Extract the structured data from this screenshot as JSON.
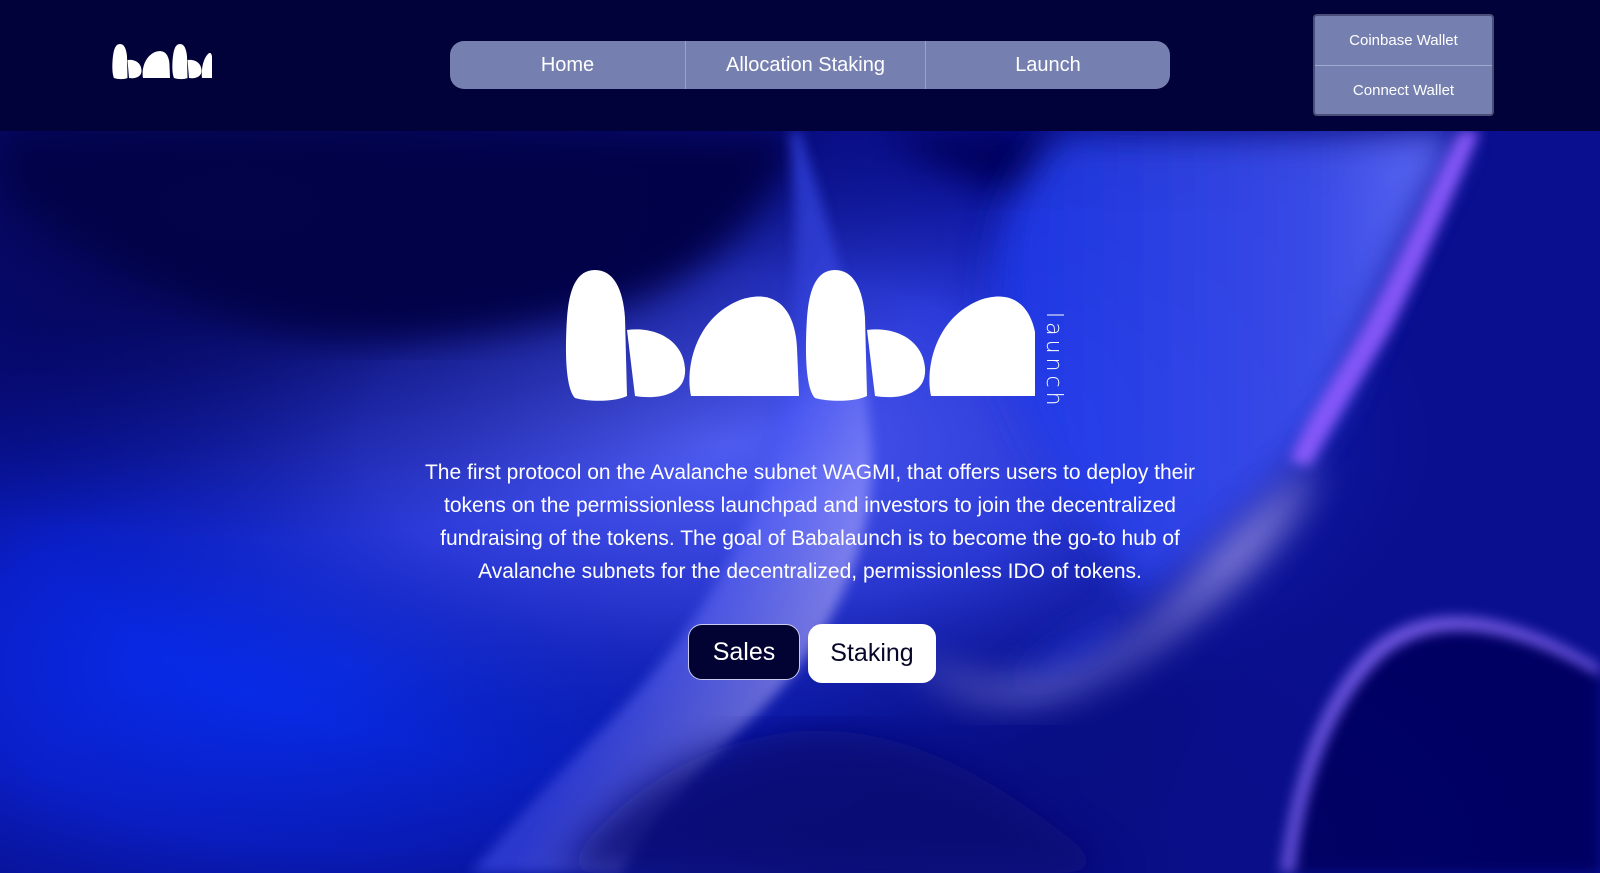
{
  "header": {
    "logo_alt": "baba",
    "nav": [
      {
        "label": "Home"
      },
      {
        "label": "Allocation Staking"
      },
      {
        "label": "Launch"
      }
    ],
    "wallet_menu": [
      {
        "label": "Coinbase Wallet"
      },
      {
        "label": "Connect Wallet"
      }
    ]
  },
  "hero": {
    "logo_text": "baba",
    "logo_sub": "launch",
    "description": "The first protocol on the Avalanche subnet WAGMI, that offers users to deploy their tokens on the permissionless launchpad and investors to join the decentralized fundraising of the tokens. The goal of Babalaunch is to become the go-to hub of Avalanche subnets for the decentralized, permissionless IDO of tokens.",
    "buttons": {
      "sales": "Sales",
      "staking": "Staking"
    }
  },
  "colors": {
    "background": "#02023a",
    "nav_bg": "#7680b0",
    "accent_blue": "#1a3cff",
    "accent_purple": "#8a5cff",
    "text": "#ffffff"
  }
}
